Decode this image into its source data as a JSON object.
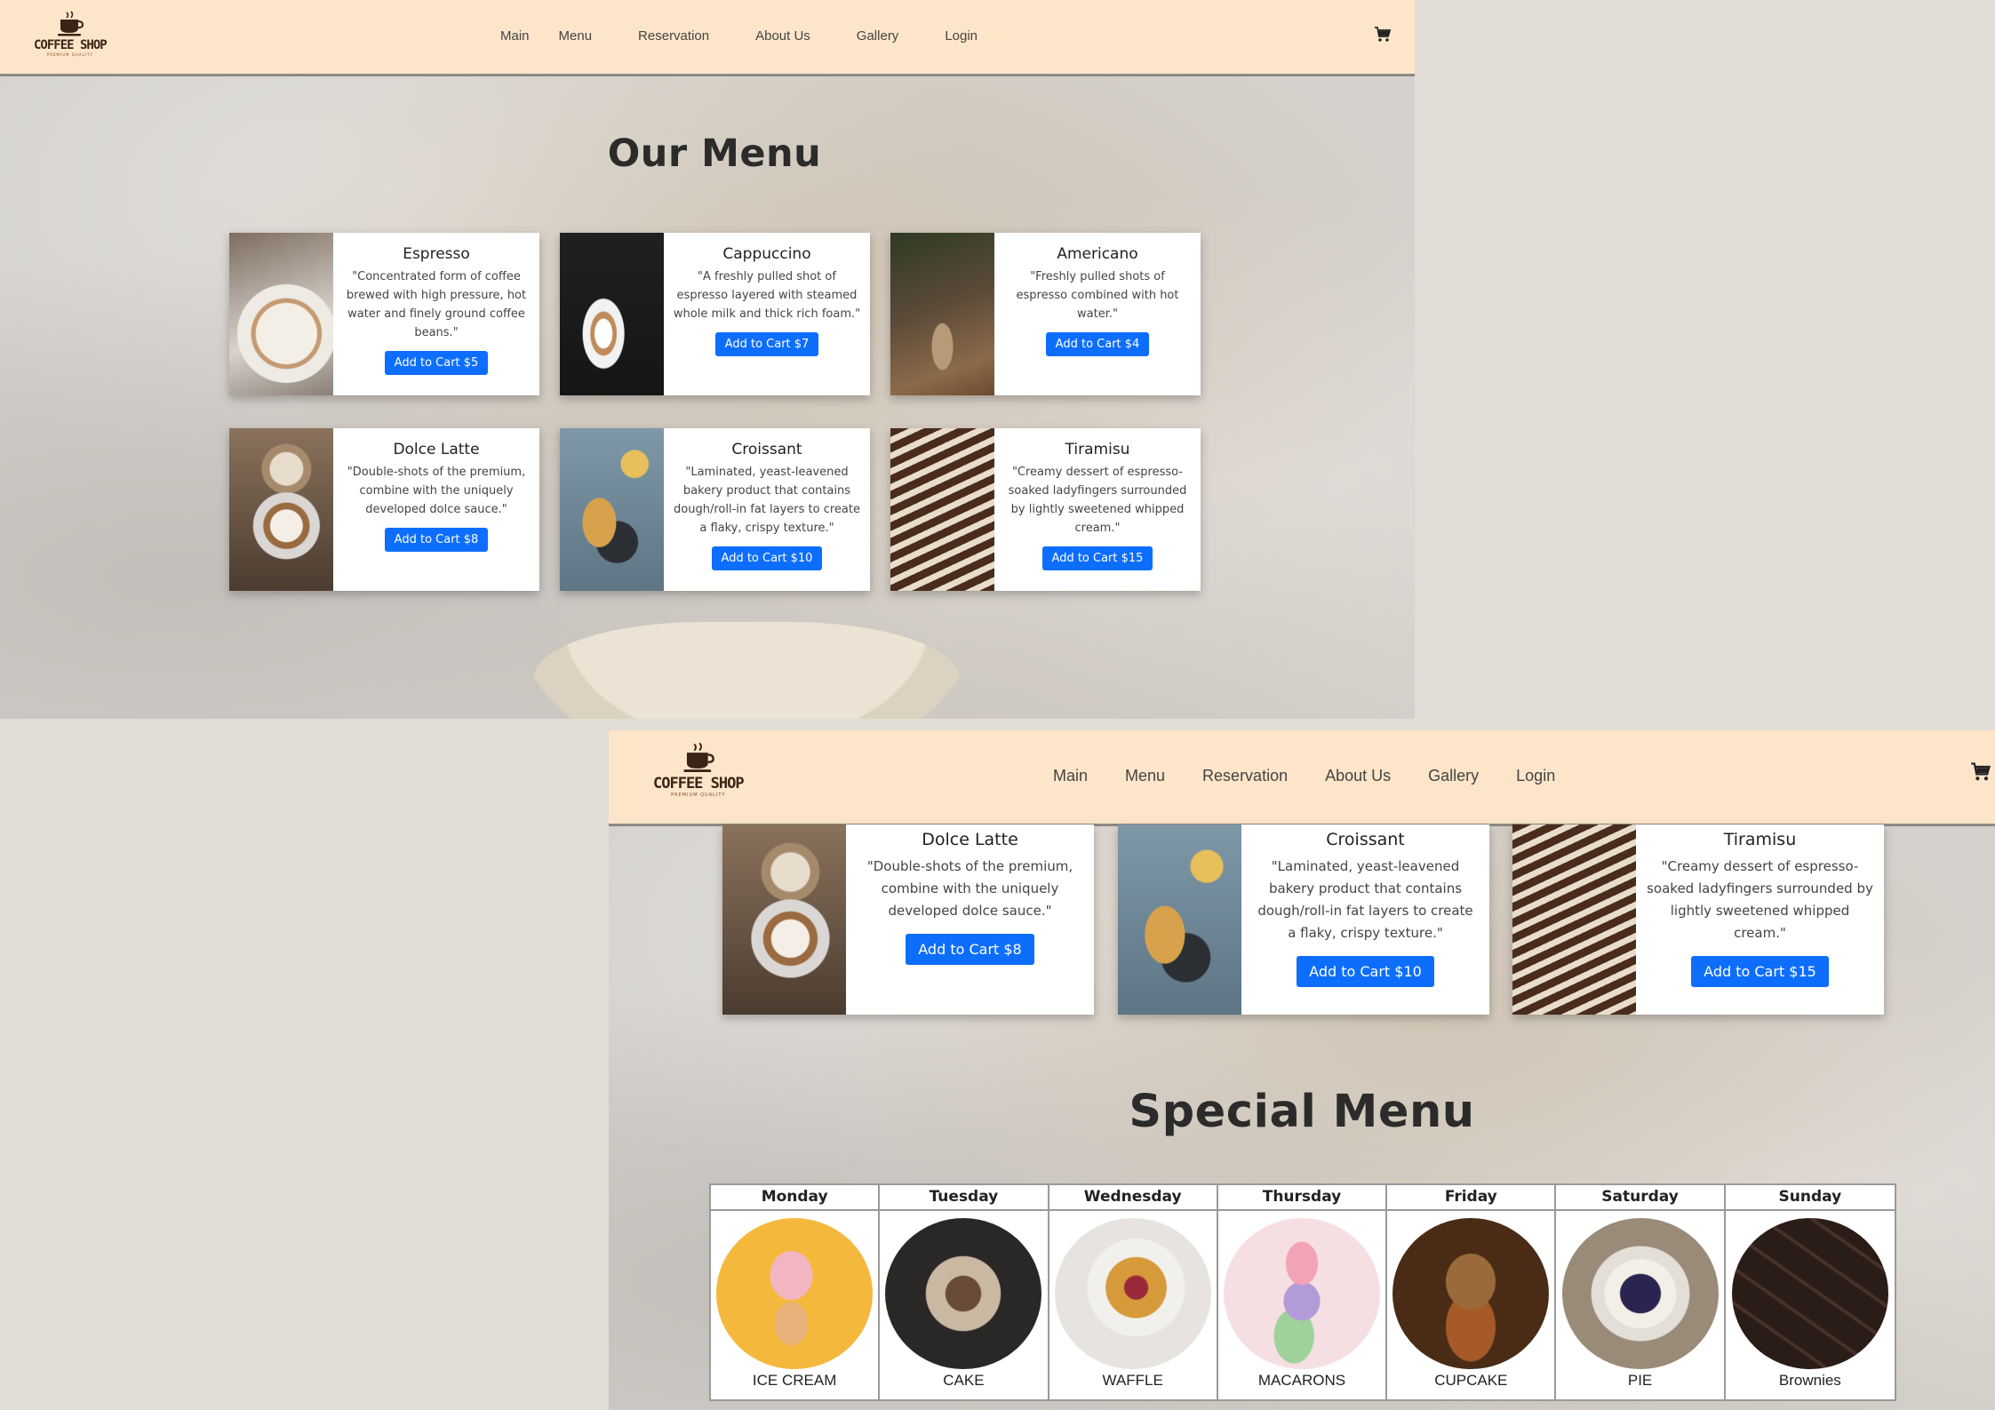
{
  "site": {
    "brand": "COFFEE SHOP",
    "tagline": "PREMIUM QUALITY",
    "nav": [
      "Main",
      "Menu",
      "Reservation",
      "About Us",
      "Gallery",
      "Login"
    ],
    "cart_icon": "shopping-cart-icon"
  },
  "menu_section": {
    "title": "Our Menu",
    "items": [
      {
        "name": "Espresso",
        "desc": "\"Concentrated form of coffee brewed with high pressure, hot water and finely ground coffee beans.\"",
        "button": "Add to Cart $5"
      },
      {
        "name": "Cappuccino",
        "desc": "\"A freshly pulled shot of espresso layered with steamed whole milk and thick rich foam.\"",
        "button": "Add to Cart $7"
      },
      {
        "name": "Americano",
        "desc": "\"Freshly pulled shots of espresso combined with hot water.\"",
        "button": "Add to Cart $4"
      },
      {
        "name": "Dolce Latte",
        "desc": "\"Double-shots of the premium, combine with the uniquely developed dolce sauce.\"",
        "button": "Add to Cart $8"
      },
      {
        "name": "Croissant",
        "desc": "\"Laminated, yeast-leavened bakery product that contains dough/roll-in fat layers to create a flaky, crispy texture.\"",
        "button": "Add to Cart $10"
      },
      {
        "name": "Tiramisu",
        "desc": "\"Creamy dessert of espresso-soaked ladyfingers surrounded by lightly sweetened whipped cream.\"",
        "button": "Add to Cart $15"
      }
    ]
  },
  "special_menu": {
    "title": "Special Menu",
    "days": [
      {
        "day": "Monday",
        "item": "ICE CREAM"
      },
      {
        "day": "Tuesday",
        "item": "CAKE"
      },
      {
        "day": "Wednesday",
        "item": "WAFFLE"
      },
      {
        "day": "Thursday",
        "item": "MACARONS"
      },
      {
        "day": "Friday",
        "item": "CUPCAKE"
      },
      {
        "day": "Saturday",
        "item": "PIE"
      },
      {
        "day": "Sunday",
        "item": "Brownies"
      }
    ]
  },
  "colors": {
    "navbar": "#fde5c9",
    "button": "#0d6efd",
    "page_bg": "#e2dcd6"
  }
}
